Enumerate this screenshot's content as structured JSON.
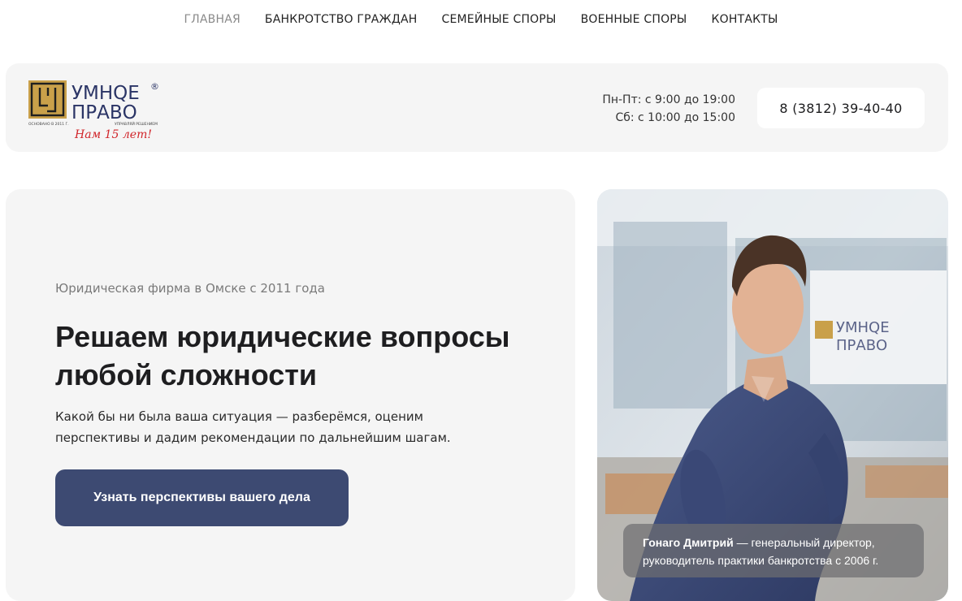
{
  "nav": {
    "items": [
      {
        "label": "ГЛАВНАЯ",
        "active": true
      },
      {
        "label": "БАНКРОТСТВО ГРАЖДАН",
        "active": false
      },
      {
        "label": "СЕМЕЙНЫЕ СПОРЫ",
        "active": false
      },
      {
        "label": "ВОЕННЫЕ СПОРЫ",
        "active": false
      },
      {
        "label": "КОНТАКТЫ",
        "active": false
      }
    ]
  },
  "header": {
    "logo": {
      "line1": "УМНQЕ",
      "line2": "ПРАВО",
      "registered": "®",
      "founded": "ОСНОВАНО В 2011 Г.",
      "tagline": "УПРАВЛЯЙ РЕШЕНИЕМ",
      "anniversary": "Нам 15 лет!"
    },
    "hours_weekday": "Пн-Пт: с 9:00 до 19:00",
    "hours_saturday": "Сб: с 10:00 до 15:00",
    "phone": "8 (3812) 39-40-40"
  },
  "hero": {
    "subtitle": "Юридическая фирма в Омске с 2011 года",
    "title": "Решаем юридические вопросы любой сложности",
    "description": "Какой бы ни была ваша ситуация — разберёмся, оценим перспективы и дадим рекомендации по дальнейшим шагам.",
    "cta_label": "Узнать перспективы вашего дела"
  },
  "photo": {
    "caption_name": "Гонаго Дмитрий",
    "caption_rest": " — генеральный директор, руководитель практики банкротства с 2006 г.",
    "sign_line1": "УМНQЕ",
    "sign_line2": "ПРАВО"
  },
  "colors": {
    "accent": "#3d4a72",
    "panel": "#f5f5f5",
    "logo_gold": "#c9a04a",
    "logo_navy": "#2b3566",
    "anniversary_red": "#d1262b"
  }
}
